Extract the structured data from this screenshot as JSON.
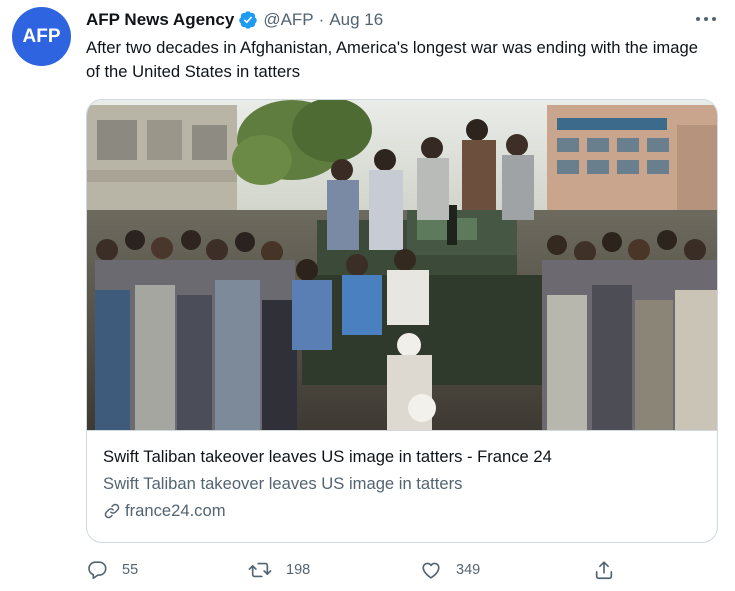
{
  "tweet": {
    "avatar_text": "AFP",
    "display_name": "AFP News Agency",
    "verified_icon": "verified-badge-icon",
    "handle": "@AFP",
    "separator": "·",
    "date": "Aug 16",
    "text": "After two decades in Afghanistan, America's longest war was ending with the image of the United States in tatters"
  },
  "card": {
    "title": "Swift Taliban takeover leaves US image in tatters - France 24",
    "description": "Swift Taliban takeover leaves US image in tatters",
    "domain": "france24.com",
    "link_icon": "link-icon"
  },
  "actions": {
    "reply_count": "55",
    "retweet_count": "198",
    "like_count": "349"
  },
  "colors": {
    "accent": "#1d9bf0",
    "avatar_bg": "#2f64e0",
    "secondary_text": "#536471",
    "border": "#cfd9de"
  }
}
